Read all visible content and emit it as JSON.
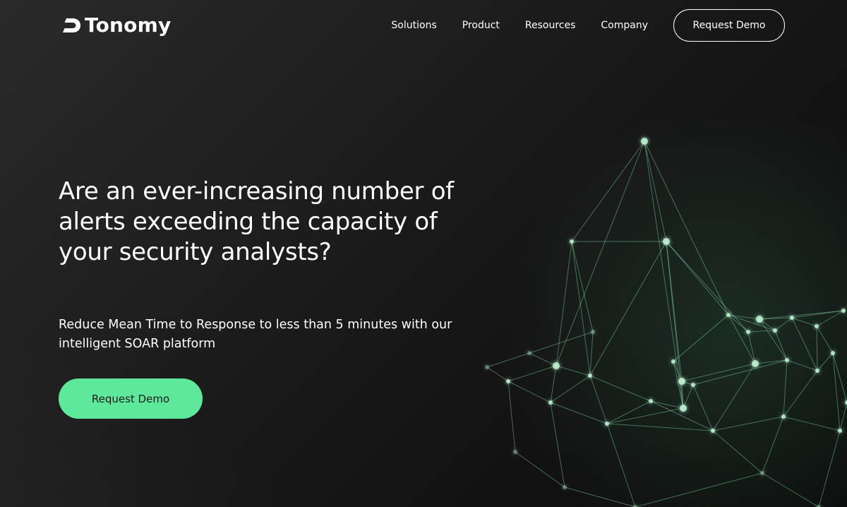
{
  "brand": {
    "name": "Tonomy",
    "logo_icon": "stylized-d-icon",
    "accent_color": "#5ee89b",
    "background_color": "#1c1c1c"
  },
  "nav": {
    "items": [
      {
        "label": "Solutions"
      },
      {
        "label": "Product"
      },
      {
        "label": "Resources"
      },
      {
        "label": "Company"
      }
    ],
    "cta_label": "Request Demo"
  },
  "hero": {
    "title": "Are an ever-increasing number of alerts exceeding the capacity of your security analysts?",
    "subtitle": "Reduce Mean Time to Response to less than 5 minutes with our intelligent SOAR platform",
    "cta_label": "Request Demo"
  },
  "decoration": {
    "graphic": "glowing-network-mesh",
    "glow_color": "#7fe0a8"
  }
}
